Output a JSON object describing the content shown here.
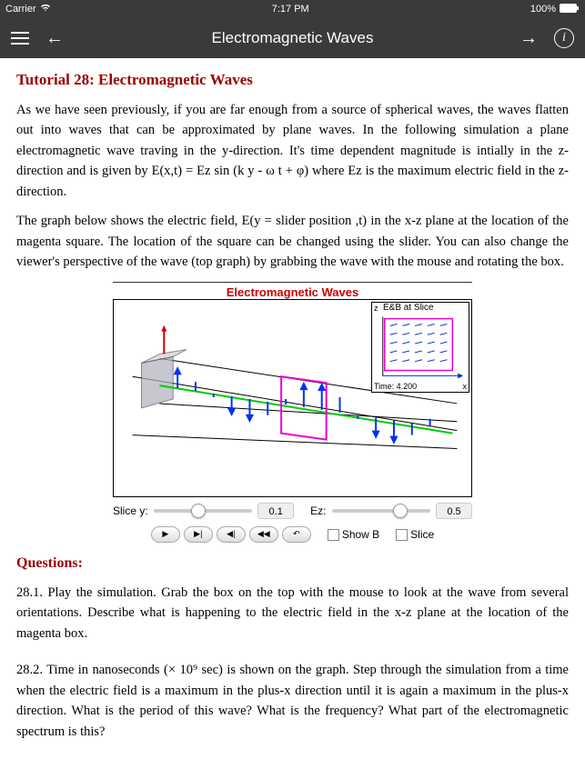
{
  "status": {
    "carrier": "Carrier",
    "time": "7:17 PM",
    "battery": "100%"
  },
  "nav": {
    "title": "Electromagnetic Waves"
  },
  "tutorial": {
    "title": "Tutorial 28: Electromagnetic Waves",
    "p1": "As we have seen previously, if you are far enough from a source of spherical waves, the waves flatten out into waves that can be approximated by plane waves. In the following simulation a plane electromagnetic wave traving in the y-direction. It's time dependent magnitude is intially in the z-direction and is given by E(x,t) = Ez sin (k y - ω t + φ) where Ez is the maximum electric field in the z-direction.",
    "p2": "The graph below shows the electric field, E(y = slider position ,t) in the x-z plane at the location of the magenta square. The location of the square can be changed using the slider. You can also change the viewer's perspective of the wave (top graph) by grabbing the wave with the mouse and rotating the box."
  },
  "sim": {
    "title": "Electromagnetic Waves",
    "inset_title": "E&B at Slice",
    "inset_time": "Time: 4.200",
    "inset_axes": {
      "x": "x",
      "z": "z"
    },
    "slice_label": "Slice y:",
    "slice_value": "0.1",
    "ez_label": "Ez:",
    "ez_value": "0.5",
    "show_b_label": "Show B",
    "slice_cb_label": "Slice"
  },
  "chart_data": {
    "type": "vector-field-3d",
    "title": "Electromagnetic Waves",
    "description": "3D perspective box showing electric field (blue arrows) sinusoidally varying along green propagation axis (y), with magenta slice plane at y=0.1 and red z-axis indicator",
    "slice_y": 0.1,
    "ez_amplitude": 0.5,
    "time": 4.2,
    "inset": {
      "type": "vector-field-2d",
      "xlabel": "x",
      "ylabel": "z",
      "grid": "6x6 blue arrows pointing +x"
    }
  },
  "questions": {
    "title": "Questions:",
    "q1": "28.1. Play the simulation. Grab the box on the top with the mouse to look at the wave from several orientations. Describe what is happening to the electric field in the x-z plane at the location of the magenta box.",
    "q2": "28.2. Time in nanoseconds (× 10⁹ sec) is shown on the graph. Step through the simulation from a time when the electric field is a maximum in the plus-x direction until it is again a maximum in the plus-x direction. What is the period of this wave? What is the frequency? What part of the electromagnetic spectrum is this?"
  }
}
